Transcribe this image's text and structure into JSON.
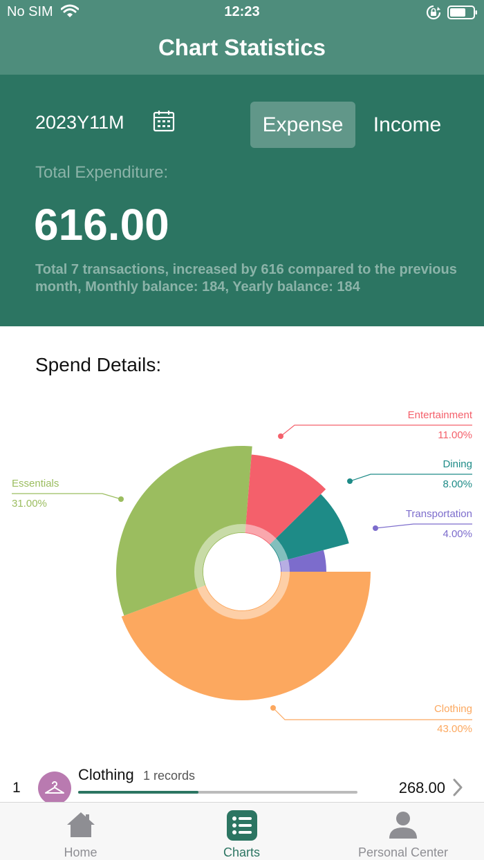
{
  "status_bar": {
    "carrier": "No SIM",
    "time": "12:23"
  },
  "nav": {
    "title": "Chart Statistics"
  },
  "summary": {
    "month": "2023Y11M",
    "expense_tab": "Expense",
    "income_tab": "Income",
    "selected_tab": "Expense",
    "total_label": "Total Expenditure:",
    "total_value": "616.00",
    "description": "Total 7 transactions, increased by 616 compared to the previous month, Monthly balance: 184,  Yearly balance: 184"
  },
  "spend_details_title": "Spend Details:",
  "chart_data": {
    "type": "pie",
    "style": "nightingale-rose donut",
    "categories": [
      "Clothing",
      "Essentials",
      "Entertainment",
      "Dining",
      "Transportation"
    ],
    "values": [
      43.0,
      31.0,
      11.0,
      8.0,
      4.0
    ],
    "labels": [
      "43.00%",
      "31.00%",
      "11.00%",
      "8.00%",
      "4.00%"
    ],
    "colors": [
      "#fca85f",
      "#9bbd5f",
      "#f4606b",
      "#1e8b87",
      "#7c6ccc"
    ]
  },
  "list": [
    {
      "rank": "1",
      "name": "Clothing",
      "records": "1 records",
      "amount": "268.00",
      "progress": 0.43,
      "icon": "hanger-icon",
      "icon_color": "#b97ab0"
    }
  ],
  "tabbar": {
    "items": [
      {
        "label": "Home",
        "icon": "home-icon"
      },
      {
        "label": "Charts",
        "icon": "list-icon"
      },
      {
        "label": "Personal Center",
        "icon": "person-icon"
      }
    ],
    "active": "Charts"
  },
  "colors": {
    "primary": "#2c7562",
    "nav": "#4e8d7c"
  }
}
